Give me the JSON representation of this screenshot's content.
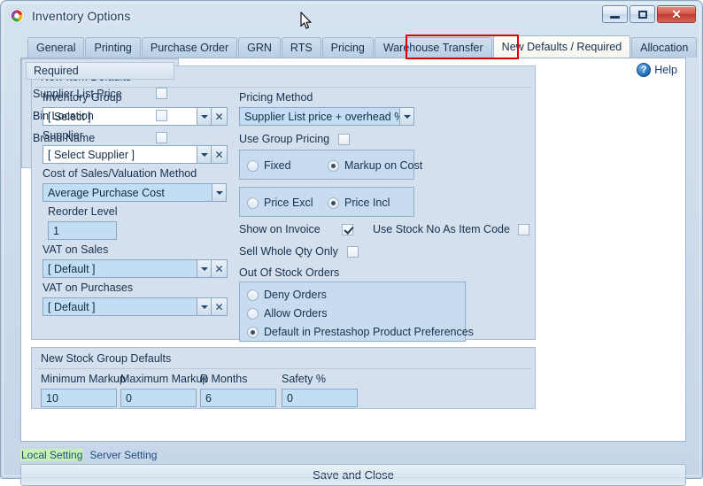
{
  "window": {
    "title": "Inventory Options",
    "app_icon": "swirl-logo-icon",
    "minimize_label": "",
    "maximize_label": "",
    "close_label": "✕"
  },
  "tabs": [
    {
      "label": "General",
      "active": false
    },
    {
      "label": "Printing",
      "active": false
    },
    {
      "label": "Purchase Order",
      "active": false
    },
    {
      "label": "GRN",
      "active": false
    },
    {
      "label": "RTS",
      "active": false
    },
    {
      "label": "Pricing",
      "active": false
    },
    {
      "label": "Warehouse Transfer",
      "active": false
    },
    {
      "label": "New Defaults / Required",
      "active": true
    },
    {
      "label": "Allocation",
      "active": false
    }
  ],
  "help": {
    "label": "Help",
    "icon": "question-mark-icon"
  },
  "new_item_defaults": {
    "title": "New Item Defaults",
    "inventory_group": {
      "label": "Inventory Group",
      "value": "[ Select ]"
    },
    "supplier": {
      "label": "Supplier",
      "value": "[ Select Supplier ]"
    },
    "cost_of_sales": {
      "label": "Cost of Sales/Valuation Method",
      "value": "Average Purchase Cost"
    },
    "reorder_level": {
      "label": "Reorder Level",
      "value": "1"
    },
    "vat_on_sales": {
      "label": "VAT on Sales",
      "value": "[ Default ]"
    },
    "vat_on_purchases": {
      "label": "VAT on Purchases",
      "value": "[ Default ]"
    },
    "pricing_method": {
      "label": "Pricing Method",
      "value": "Supplier List price + overhead %"
    },
    "use_group_pricing": {
      "label": "Use Group Pricing",
      "checked": false
    },
    "markup_mode": {
      "options": [
        "Fixed",
        "Markup on Cost"
      ],
      "selected": "Markup on Cost"
    },
    "price_mode": {
      "options": [
        "Price Excl",
        "Price Incl"
      ],
      "selected": "Price Incl"
    },
    "show_on_invoice": {
      "label": "Show on Invoice",
      "checked": true
    },
    "use_stock_no_as_item_code": {
      "label": "Use Stock No As Item Code",
      "checked": false
    },
    "sell_whole_qty_only": {
      "label": "Sell Whole Qty Only",
      "checked": false
    },
    "out_of_stock_orders": {
      "label": "Out Of Stock Orders",
      "options": [
        "Deny Orders",
        "Allow Orders",
        "Default in Prestashop Product Preferences"
      ],
      "selected": "Default in Prestashop Product Preferences"
    }
  },
  "required": {
    "title": "Required",
    "rows": [
      {
        "label": "Supplier List Price",
        "checked": false
      },
      {
        "label": "Bin Location",
        "checked": false
      },
      {
        "label": "Brand Name",
        "checked": false
      }
    ]
  },
  "stock_group_defaults": {
    "title": "New Stock Group Defaults",
    "fields": [
      {
        "label": "Minimum Markup",
        "value": "10"
      },
      {
        "label": "Maximum Markup",
        "value": "0"
      },
      {
        "label": "R Months",
        "value": "6"
      },
      {
        "label": "Safety %",
        "value": "0"
      }
    ]
  },
  "footer": {
    "local_setting": "Local Setting",
    "server_setting": "Server Setting",
    "save_and_close": "Save and Close"
  },
  "colors": {
    "accent": "#16314f",
    "panel": "#d4e0ee",
    "field": "#c3ddf2",
    "highlight_red": "#d80000",
    "local_setting_bg": "#c6f0b4"
  }
}
